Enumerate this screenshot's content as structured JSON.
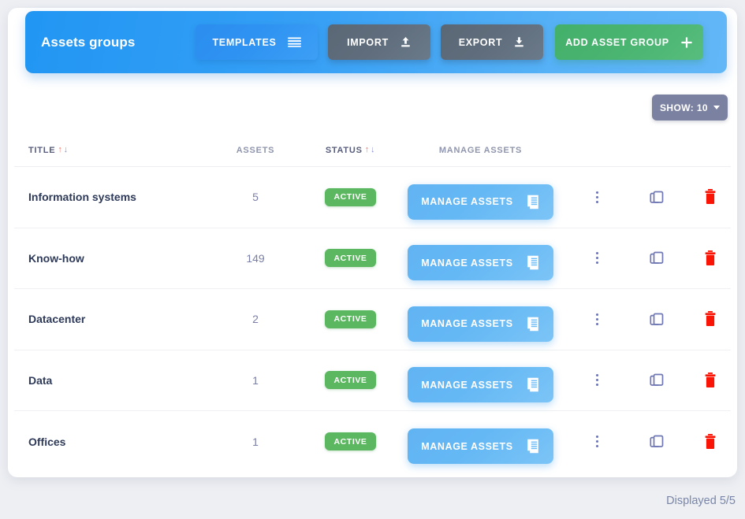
{
  "header": {
    "title": "Assets groups",
    "buttons": [
      {
        "label": "TEMPLATES",
        "icon": "list-lines-icon"
      },
      {
        "label": "IMPORT",
        "icon": "upload-icon"
      },
      {
        "label": "EXPORT",
        "icon": "download-icon"
      },
      {
        "label": "ADD ASSET GROUP",
        "icon": "plus-icon"
      }
    ],
    "colors": {
      "blue_left": "#2196f3",
      "blue_right": "#62b7f7",
      "green": "#4ab471",
      "slate": "#5f6d7c"
    }
  },
  "toolbar": {
    "show": {
      "label": "SHOW: 10",
      "value": "10",
      "icon": "chevron-down-icon",
      "color": "#7b81a0"
    }
  },
  "table": {
    "columns": [
      {
        "key": "title",
        "label": "TITLE",
        "sortable": true
      },
      {
        "key": "assets",
        "label": "ASSETS",
        "sortable": false
      },
      {
        "key": "status",
        "label": "STATUS",
        "sortable": true
      },
      {
        "key": "manage",
        "label": "MANAGE ASSETS",
        "sortable": false
      }
    ],
    "sort_icons": {
      "asc": "↑",
      "desc": "↓",
      "asc_color": "#f4736b",
      "desc_color": "#8a8fd4"
    },
    "row_actions": {
      "manage_label": "MANAGE ASSETS",
      "manage_icon": "document-list-icon",
      "menu_icon": "more-vertical-icon",
      "copy_icon": "duplicate-icon",
      "delete_icon": "trash-icon",
      "delete_color": "#fa1405"
    },
    "rows": [
      {
        "title": "Information systems",
        "assets": "5",
        "status": "ACTIVE"
      },
      {
        "title": "Know-how",
        "assets": "149",
        "status": "ACTIVE"
      },
      {
        "title": "Datacenter",
        "assets": "2",
        "status": "ACTIVE"
      },
      {
        "title": "Data",
        "assets": "1",
        "status": "ACTIVE"
      },
      {
        "title": "Offices",
        "assets": "1",
        "status": "ACTIVE"
      }
    ]
  },
  "footer": {
    "displayed": "Displayed 5/5"
  }
}
